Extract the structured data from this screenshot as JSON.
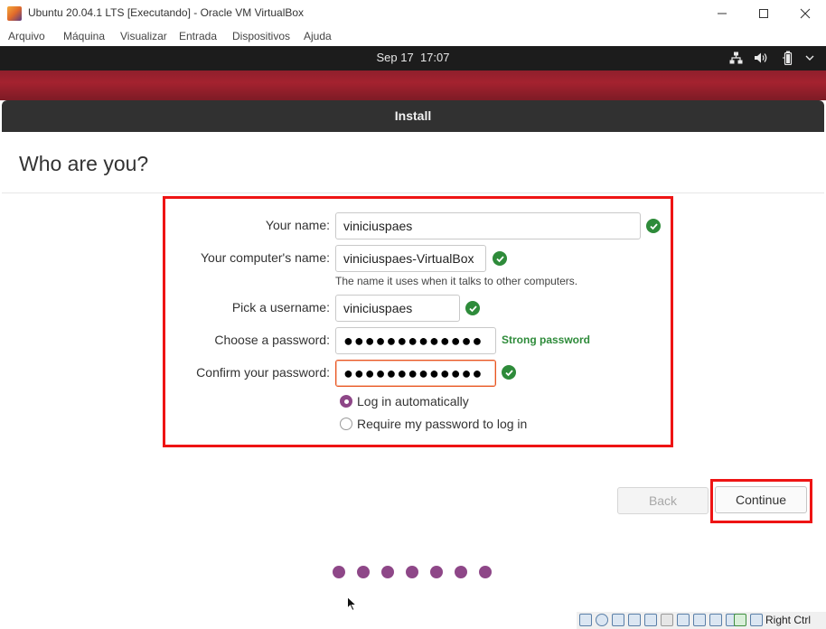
{
  "vbox": {
    "title": "Ubuntu 20.04.1 LTS [Executando] - Oracle VM VirtualBox",
    "menu": [
      "Arquivo",
      "Máquina",
      "Visualizar",
      "Entrada",
      "Dispositivos",
      "Ajuda"
    ],
    "host_key": "Right Ctrl"
  },
  "panel": {
    "date": "Sep 17",
    "time": "17:07"
  },
  "installer": {
    "window_title": "Install",
    "heading": "Who are you?",
    "form": {
      "name_label": "Your name:",
      "name_value": "viniciuspaes",
      "computer_label": "Your computer's name:",
      "computer_value": "viniciuspaes-VirtualBox",
      "computer_hint": "The name it uses when it talks to other computers.",
      "username_label": "Pick a username:",
      "username_value": "viniciuspaes",
      "password_label": "Choose a password:",
      "password_value": "●●●●●●●●●●●●●",
      "password_strength": "Strong password",
      "confirm_label": "Confirm your password:",
      "confirm_value": "●●●●●●●●●●●●●",
      "login_auto_label": "Log in automatically",
      "login_password_label": "Require my password to log in",
      "login_selected": "Log in automatically"
    },
    "buttons": {
      "back": "Back",
      "continue": "Continue"
    },
    "progress": {
      "total_steps": 7
    }
  },
  "colors": {
    "accent": "#8e4788",
    "ubuntu_orange": "#e95420",
    "success": "#2e8b3a",
    "highlight": "#ee1414",
    "desktop_red": "#a4222f"
  }
}
